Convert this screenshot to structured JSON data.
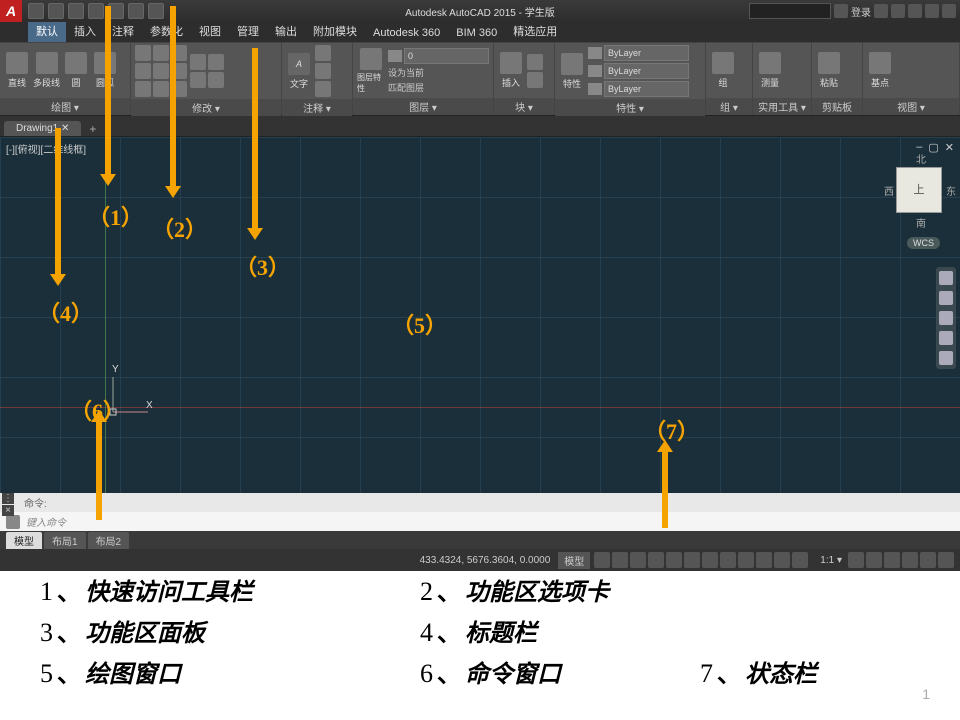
{
  "title_bar": {
    "app_title": "Autodesk AutoCAD 2015 - 学生版",
    "login": "登录",
    "search_placeholder": ""
  },
  "ribbon_tabs": [
    "默认",
    "插入",
    "注释",
    "参数化",
    "视图",
    "管理",
    "输出",
    "附加模块",
    "Autodesk 360",
    "BIM 360",
    "精选应用"
  ],
  "ribbon_active_index": 0,
  "panels": {
    "draw": {
      "title": "绘图 ▾",
      "btns": [
        "直线",
        "多段线",
        "圆",
        "圆弧"
      ]
    },
    "modify": {
      "title": "修改 ▾",
      "btns": [
        "移动",
        "旋转",
        "修剪",
        "复制",
        "镜像",
        "圆角",
        "拉伸",
        "缩放",
        "阵列"
      ]
    },
    "annot": {
      "title": "注释 ▾",
      "btn": "文字"
    },
    "layer": {
      "title": "图层 ▾",
      "btn": "图层特性",
      "opts": [
        "设为当前",
        "匹配图层"
      ]
    },
    "block": {
      "title": "块 ▾",
      "btn": "插入"
    },
    "prop": {
      "title": "特性 ▾",
      "btn": "特性",
      "val": "ByLayer"
    },
    "group": {
      "title": "组 ▾",
      "btn": "组"
    },
    "util": {
      "title": "实用工具 ▾",
      "btn": "测量"
    },
    "clip": {
      "title": "剪贴板",
      "btn": "粘贴"
    },
    "view": {
      "title": "视图 ▾",
      "btn": "基点"
    }
  },
  "file_tab": "Drawing1 ✕",
  "viewport": {
    "label": "[-][俯视][二维线框]",
    "minimize": "–",
    "close": "✕",
    "viewcube_face": "上",
    "vc_n": "北",
    "vc_s": "南",
    "vc_e": "东",
    "vc_w": "西",
    "wcs": "WCS",
    "ucs_x": "X",
    "ucs_y": "Y"
  },
  "command": {
    "history": "命令:",
    "prompt": "键入命令"
  },
  "layout_tabs": [
    "模型",
    "布局1",
    "布局2"
  ],
  "layout_active_index": 0,
  "status": {
    "coords": "433.4324, 5676.3604, 0.0000",
    "model": "模型",
    "scale": "1:1 ▾"
  },
  "annotations": {
    "a1": "（1）",
    "a2": "（2）",
    "a3": "（3）",
    "a4": "（4）",
    "a5": "（5）",
    "a6": "（6）",
    "a7": "（7）"
  },
  "legend": [
    {
      "n": "1",
      "t": "快速访问工具栏"
    },
    {
      "n": "2",
      "t": "功能区选项卡"
    },
    {
      "n": "3",
      "t": "功能区面板"
    },
    {
      "n": "4",
      "t": "标题栏"
    },
    {
      "n": "5",
      "t": "绘图窗口"
    },
    {
      "n": "6",
      "t": "命令窗口"
    },
    {
      "n": "7",
      "t": "状态栏"
    }
  ],
  "slide_num": "1"
}
